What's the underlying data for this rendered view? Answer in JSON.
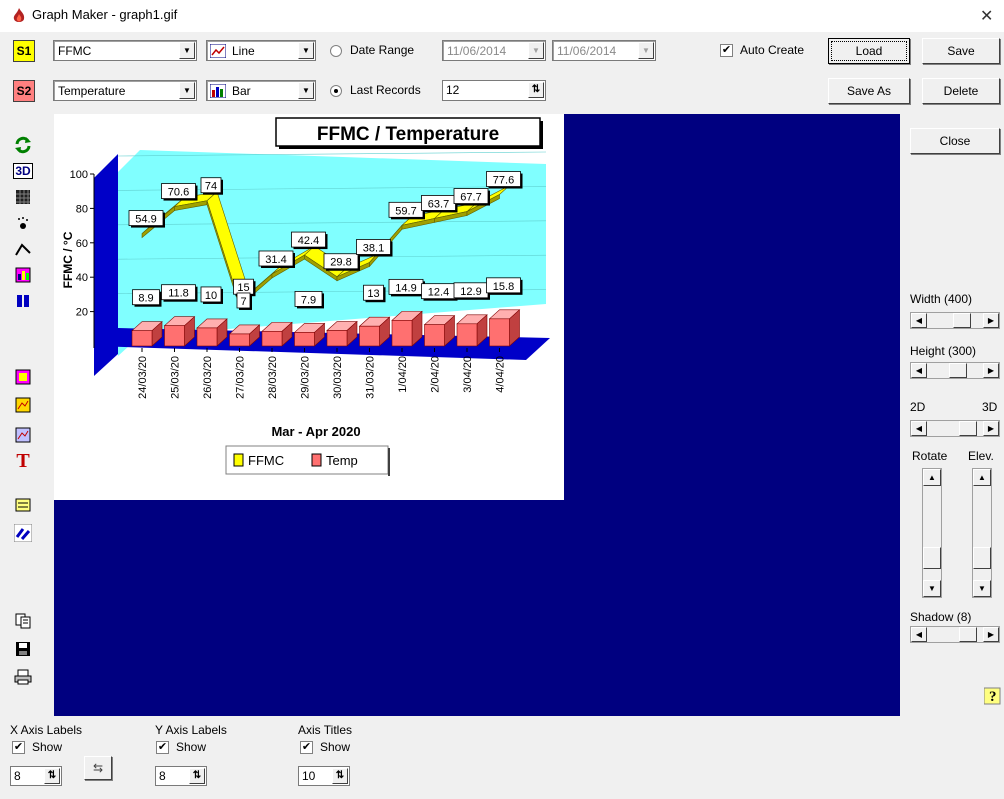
{
  "window": {
    "title": "Graph Maker - graph1.gif",
    "close": "✕"
  },
  "toolbar": {
    "s1": {
      "badge": "S1",
      "series": "FFMC",
      "type": "Line",
      "color": "#ffff00"
    },
    "s2": {
      "badge": "S2",
      "series": "Temperature",
      "type": "Bar",
      "color": "#ff8080"
    },
    "date_range_label": "Date Range",
    "date_from": "11/06/2014",
    "date_to": "11/06/2014",
    "last_records_label": "Last Records",
    "last_records_value": "12",
    "auto_create_label": "Auto Create",
    "auto_create_checked": true,
    "load": "Load",
    "save": "Save",
    "save_as": "Save As",
    "delete": "Delete"
  },
  "tools": [
    "refresh-icon",
    "3d-toggle-icon",
    "grid-icon",
    "marker-icon",
    "line-style-icon",
    "palette-icon",
    "series-color-icon",
    "background-icon",
    "gradient-icon",
    "panel-icon",
    "text-title-icon",
    "legend-icon",
    "axis-swap-icon",
    "copy-icon",
    "save-disk-icon",
    "print-icon"
  ],
  "tool_labels": {
    "3d": "3D",
    "text": "T"
  },
  "right": {
    "close": "Close",
    "width_label": "Width (400)",
    "height_label": "Height (300)",
    "label_2d": "2D",
    "label_3d": "3D",
    "rotate_label": "Rotate",
    "elev_label": "Elev.",
    "shadow_label": "Shadow (8)",
    "help": "?"
  },
  "bottom": {
    "x_axis_labels": "X Axis Labels",
    "y_axis_labels": "Y Axis Labels",
    "axis_titles": "Axis Titles",
    "show": "Show",
    "x_size": "8",
    "y_size": "8",
    "title_size": "10"
  },
  "chart_data": {
    "type": "bar",
    "title": "FFMC / Temperature",
    "xlabel": "Mar - Apr 2020",
    "ylabel": "FFMC / °C",
    "ylim": [
      0,
      100
    ],
    "yticks": [
      "20",
      "40",
      "60",
      "80",
      "100"
    ],
    "categories": [
      "24/03/20",
      "25/03/20",
      "26/03/20",
      "27/03/20",
      "28/03/20",
      "29/03/20",
      "30/03/20",
      "31/03/20",
      "1/04/20",
      "2/04/20",
      "3/04/20",
      "4/04/20"
    ],
    "series": [
      {
        "name": "FFMC",
        "type": "line",
        "color": "#ffff00",
        "values": [
          54.9,
          70.6,
          74,
          15,
          31.4,
          42.4,
          29.8,
          38.1,
          59.7,
          63.7,
          67.7,
          77.6
        ]
      },
      {
        "name": "Temp",
        "type": "bar",
        "color": "#ff7070",
        "values": [
          8.9,
          11.8,
          10.5,
          7,
          8.5,
          7.9,
          9,
          11.5,
          14.9,
          12.4,
          12.9,
          15.8
        ]
      }
    ],
    "point_labels": {
      "FFMC": [
        "54.9",
        "70.6",
        "74",
        "15",
        "31.4",
        "42.4",
        "29.8",
        "38.1",
        "59.7",
        "63.7",
        "67.7",
        "77.6"
      ],
      "Temp": [
        "8.9",
        "11.8",
        "10",
        "7",
        "",
        "7.9",
        "",
        "13",
        "14.9",
        "12.4",
        "12.9",
        "15.8"
      ]
    },
    "legend": [
      "FFMC",
      "Temp"
    ],
    "legend_position": "bottom",
    "grid": false,
    "view": "3d"
  }
}
